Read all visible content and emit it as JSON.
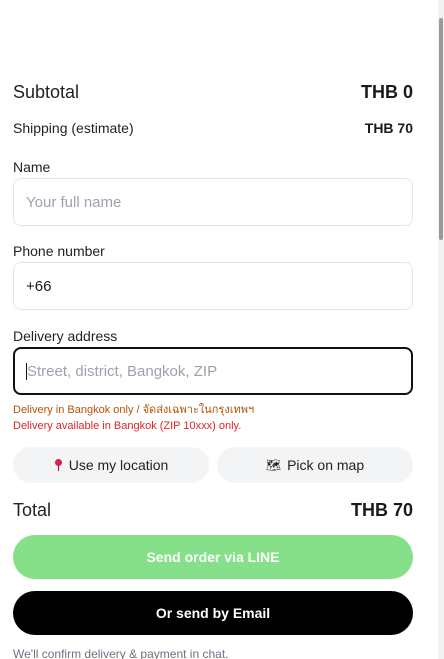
{
  "summary": {
    "subtotal_label": "Subtotal",
    "subtotal_value": "THB 0",
    "shipping_label": "Shipping (estimate)",
    "shipping_value": "THB 70",
    "total_label": "Total",
    "total_value": "THB 70"
  },
  "form": {
    "name_label": "Name",
    "name_placeholder": "Your full name",
    "phone_label": "Phone number",
    "phone_value": "+66",
    "address_label": "Delivery address",
    "address_placeholder": "Street, district, Bangkok, ZIP",
    "error_bilingual": "Delivery in Bangkok only / จัดส่งเฉพาะในกรุงเทพฯ",
    "error_zip": "Delivery available in Bangkok (ZIP 10xxx) only."
  },
  "location": {
    "use_location_label": "Use my location",
    "pick_on_map_label": "Pick on map"
  },
  "actions": {
    "line_button_label": "Send order via LINE",
    "email_button_label": "Or send by Email"
  },
  "footer": {
    "note": "We'll confirm delivery & payment in chat."
  },
  "colors": {
    "line_button": "#86e08a",
    "email_button": "#000000",
    "error_warning": "#b45309",
    "error_text": "#dc2626"
  }
}
